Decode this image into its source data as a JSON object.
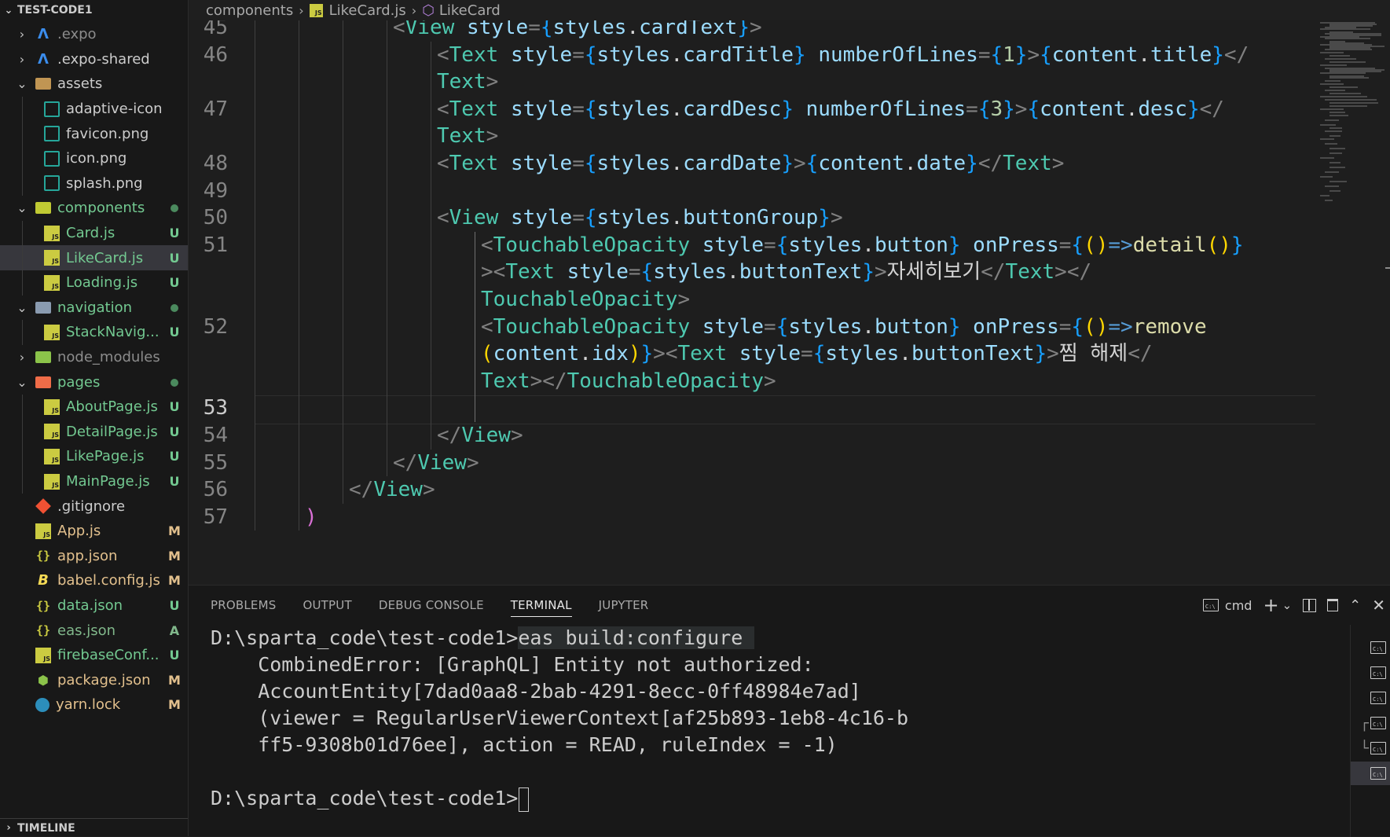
{
  "explorer": {
    "root": "TEST-CODE1",
    "items": [
      {
        "type": "folder",
        "name": ".expo",
        "icon": "expo-folder-icon",
        "expanded": false,
        "depth": 0,
        "status": ""
      },
      {
        "type": "folder",
        "name": ".expo-shared",
        "icon": "expo-folder-icon",
        "expanded": false,
        "depth": 0,
        "status": ""
      },
      {
        "type": "folder",
        "name": "assets",
        "icon": "assets-folder-icon",
        "expanded": true,
        "depth": 0,
        "status": ""
      },
      {
        "type": "file",
        "name": "adaptive-icon.png",
        "icon": "image-file-icon",
        "depth": 1,
        "status": ""
      },
      {
        "type": "file",
        "name": "favicon.png",
        "icon": "image-file-icon",
        "depth": 1,
        "status": ""
      },
      {
        "type": "file",
        "name": "icon.png",
        "icon": "image-file-icon",
        "depth": 1,
        "status": ""
      },
      {
        "type": "file",
        "name": "splash.png",
        "icon": "image-file-icon",
        "depth": 1,
        "status": ""
      },
      {
        "type": "folder",
        "name": "components",
        "icon": "components-folder-icon",
        "expanded": true,
        "depth": 0,
        "status": "dot"
      },
      {
        "type": "file",
        "name": "Card.js",
        "icon": "js-file-icon",
        "depth": 1,
        "status": "U"
      },
      {
        "type": "file",
        "name": "LikeCard.js",
        "icon": "js-file-icon",
        "depth": 1,
        "status": "U",
        "active": true
      },
      {
        "type": "file",
        "name": "Loading.js",
        "icon": "js-file-icon",
        "depth": 1,
        "status": "U"
      },
      {
        "type": "folder",
        "name": "navigation",
        "icon": "navigation-folder-icon",
        "expanded": true,
        "depth": 0,
        "status": "dot"
      },
      {
        "type": "file",
        "name": "StackNavig...",
        "icon": "js-file-icon",
        "depth": 1,
        "status": "U"
      },
      {
        "type": "folder",
        "name": "node_modules",
        "icon": "node-modules-folder-icon",
        "expanded": false,
        "depth": 0,
        "status": "",
        "dim": true
      },
      {
        "type": "folder",
        "name": "pages",
        "icon": "pages-folder-icon",
        "expanded": true,
        "depth": 0,
        "status": "dot"
      },
      {
        "type": "file",
        "name": "AboutPage.js",
        "icon": "js-file-icon",
        "depth": 1,
        "status": "U"
      },
      {
        "type": "file",
        "name": "DetailPage.js",
        "icon": "js-file-icon",
        "depth": 1,
        "status": "U"
      },
      {
        "type": "file",
        "name": "LikePage.js",
        "icon": "js-file-icon",
        "depth": 1,
        "status": "U"
      },
      {
        "type": "file",
        "name": "MainPage.js",
        "icon": "js-file-icon",
        "depth": 1,
        "status": "U"
      },
      {
        "type": "file",
        "name": ".gitignore",
        "icon": "git-file-icon",
        "depth": 0,
        "status": ""
      },
      {
        "type": "file",
        "name": "App.js",
        "icon": "js-file-icon",
        "depth": 0,
        "status": "M"
      },
      {
        "type": "file",
        "name": "app.json",
        "icon": "json-file-icon",
        "depth": 0,
        "status": "M"
      },
      {
        "type": "file",
        "name": "babel.config.js",
        "icon": "babel-file-icon",
        "depth": 0,
        "status": "M"
      },
      {
        "type": "file",
        "name": "data.json",
        "icon": "json-file-icon",
        "depth": 0,
        "status": "U"
      },
      {
        "type": "file",
        "name": "eas.json",
        "icon": "json-file-icon",
        "depth": 0,
        "status": "A"
      },
      {
        "type": "file",
        "name": "firebaseConf...",
        "icon": "js-file-icon",
        "depth": 0,
        "status": "U"
      },
      {
        "type": "file",
        "name": "package.json",
        "icon": "package-json-icon",
        "depth": 0,
        "status": "M"
      },
      {
        "type": "file",
        "name": "yarn.lock",
        "icon": "yarn-file-icon",
        "depth": 0,
        "status": "M"
      }
    ],
    "timeline": "TIMELINE"
  },
  "colors": {
    "untracked": "#73c991",
    "modified": "#e2c08d",
    "added": "#81b88b",
    "dot": "#4b8a5e"
  },
  "breadcrumb": {
    "folder": "components",
    "file": "LikeCard.js",
    "symbol": "LikeCard"
  },
  "editor": {
    "current_line": "53",
    "lines": [
      {
        "num": "45",
        "indent": 4,
        "tokens": [
          [
            "p",
            "<"
          ],
          [
            "g",
            "View"
          ],
          [
            "s",
            " "
          ],
          [
            "a",
            "style"
          ],
          [
            "p",
            "="
          ],
          [
            "b3",
            "{"
          ],
          [
            "a",
            "styles"
          ],
          [
            "t",
            "."
          ],
          [
            "a",
            "cardText"
          ],
          [
            "b3",
            "}"
          ],
          [
            "p",
            ">"
          ]
        ]
      },
      {
        "num": "46",
        "indent": 5,
        "tokens": [
          [
            "p",
            "<"
          ],
          [
            "g",
            "Text"
          ],
          [
            "s",
            " "
          ],
          [
            "a",
            "style"
          ],
          [
            "p",
            "="
          ],
          [
            "b3",
            "{"
          ],
          [
            "a",
            "styles"
          ],
          [
            "t",
            "."
          ],
          [
            "a",
            "cardTitle"
          ],
          [
            "b3",
            "}"
          ],
          [
            "s",
            " "
          ],
          [
            "a",
            "numberOfLines"
          ],
          [
            "p",
            "="
          ],
          [
            "b3",
            "{"
          ],
          [
            "n",
            "1"
          ],
          [
            "b3",
            "}"
          ],
          [
            "p",
            ">"
          ],
          [
            "b3",
            "{"
          ],
          [
            "a",
            "content"
          ],
          [
            "t",
            "."
          ],
          [
            "a",
            "title"
          ],
          [
            "b3",
            "}"
          ],
          [
            "p",
            "</"
          ]
        ]
      },
      {
        "num": "",
        "indent": 5,
        "tokens": [
          [
            "g",
            "Text"
          ],
          [
            "p",
            ">"
          ]
        ]
      },
      {
        "num": "47",
        "indent": 5,
        "tokens": [
          [
            "p",
            "<"
          ],
          [
            "g",
            "Text"
          ],
          [
            "s",
            " "
          ],
          [
            "a",
            "style"
          ],
          [
            "p",
            "="
          ],
          [
            "b3",
            "{"
          ],
          [
            "a",
            "styles"
          ],
          [
            "t",
            "."
          ],
          [
            "a",
            "cardDesc"
          ],
          [
            "b3",
            "}"
          ],
          [
            "s",
            " "
          ],
          [
            "a",
            "numberOfLines"
          ],
          [
            "p",
            "="
          ],
          [
            "b3",
            "{"
          ],
          [
            "n",
            "3"
          ],
          [
            "b3",
            "}"
          ],
          [
            "p",
            ">"
          ],
          [
            "b3",
            "{"
          ],
          [
            "a",
            "content"
          ],
          [
            "t",
            "."
          ],
          [
            "a",
            "desc"
          ],
          [
            "b3",
            "}"
          ],
          [
            "p",
            "</"
          ]
        ]
      },
      {
        "num": "",
        "indent": 5,
        "tokens": [
          [
            "g",
            "Text"
          ],
          [
            "p",
            ">"
          ]
        ]
      },
      {
        "num": "48",
        "indent": 5,
        "tokens": [
          [
            "p",
            "<"
          ],
          [
            "g",
            "Text"
          ],
          [
            "s",
            " "
          ],
          [
            "a",
            "style"
          ],
          [
            "p",
            "="
          ],
          [
            "b3",
            "{"
          ],
          [
            "a",
            "styles"
          ],
          [
            "t",
            "."
          ],
          [
            "a",
            "cardDate"
          ],
          [
            "b3",
            "}"
          ],
          [
            "p",
            ">"
          ],
          [
            "b3",
            "{"
          ],
          [
            "a",
            "content"
          ],
          [
            "t",
            "."
          ],
          [
            "a",
            "date"
          ],
          [
            "b3",
            "}"
          ],
          [
            "p",
            "</"
          ],
          [
            "g",
            "Text"
          ],
          [
            "p",
            ">"
          ]
        ]
      },
      {
        "num": "49",
        "indent": 5,
        "tokens": []
      },
      {
        "num": "50",
        "indent": 5,
        "tokens": [
          [
            "p",
            "<"
          ],
          [
            "g",
            "View"
          ],
          [
            "s",
            " "
          ],
          [
            "a",
            "style"
          ],
          [
            "p",
            "="
          ],
          [
            "b3",
            "{"
          ],
          [
            "a",
            "styles"
          ],
          [
            "t",
            "."
          ],
          [
            "a",
            "buttonGroup"
          ],
          [
            "b3",
            "}"
          ],
          [
            "p",
            ">"
          ]
        ]
      },
      {
        "num": "51",
        "indent": 6,
        "tokens": [
          [
            "p",
            "<"
          ],
          [
            "g",
            "TouchableOpacity"
          ],
          [
            "s",
            " "
          ],
          [
            "a",
            "style"
          ],
          [
            "p",
            "="
          ],
          [
            "b3",
            "{"
          ],
          [
            "a",
            "styles"
          ],
          [
            "t",
            "."
          ],
          [
            "a",
            "button"
          ],
          [
            "b3",
            "}"
          ],
          [
            "s",
            " "
          ],
          [
            "a",
            "onPress"
          ],
          [
            "p",
            "="
          ],
          [
            "b3",
            "{"
          ],
          [
            "b1",
            "()"
          ],
          [
            "k",
            "=>"
          ],
          [
            "f",
            "detail"
          ],
          [
            "b1",
            "()"
          ],
          [
            "b3",
            "}"
          ]
        ]
      },
      {
        "num": "",
        "indent": 6,
        "tokens": [
          [
            "p",
            ">"
          ],
          [
            "p",
            "<"
          ],
          [
            "g",
            "Text"
          ],
          [
            "s",
            " "
          ],
          [
            "a",
            "style"
          ],
          [
            "p",
            "="
          ],
          [
            "b3",
            "{"
          ],
          [
            "a",
            "styles"
          ],
          [
            "t",
            "."
          ],
          [
            "a",
            "buttonText"
          ],
          [
            "b3",
            "}"
          ],
          [
            "p",
            ">"
          ],
          [
            "t",
            "자세히보기"
          ],
          [
            "p",
            "</"
          ],
          [
            "g",
            "Text"
          ],
          [
            "p",
            "></"
          ]
        ]
      },
      {
        "num": "",
        "indent": 6,
        "tokens": [
          [
            "g",
            "TouchableOpacity"
          ],
          [
            "p",
            ">"
          ]
        ]
      },
      {
        "num": "52",
        "indent": 6,
        "tokens": [
          [
            "p",
            "<"
          ],
          [
            "g",
            "TouchableOpacity"
          ],
          [
            "s",
            " "
          ],
          [
            "a",
            "style"
          ],
          [
            "p",
            "="
          ],
          [
            "b3",
            "{"
          ],
          [
            "a",
            "styles"
          ],
          [
            "t",
            "."
          ],
          [
            "a",
            "button"
          ],
          [
            "b3",
            "}"
          ],
          [
            "s",
            " "
          ],
          [
            "a",
            "onPress"
          ],
          [
            "p",
            "="
          ],
          [
            "b3",
            "{"
          ],
          [
            "b1",
            "()"
          ],
          [
            "k",
            "=>"
          ],
          [
            "f",
            "remove"
          ]
        ]
      },
      {
        "num": "",
        "indent": 6,
        "tokens": [
          [
            "b1",
            "("
          ],
          [
            "a",
            "content"
          ],
          [
            "t",
            "."
          ],
          [
            "a",
            "idx"
          ],
          [
            "b1",
            ")"
          ],
          [
            "b3",
            "}"
          ],
          [
            "p",
            ">"
          ],
          [
            "p",
            "<"
          ],
          [
            "g",
            "Text"
          ],
          [
            "s",
            " "
          ],
          [
            "a",
            "style"
          ],
          [
            "p",
            "="
          ],
          [
            "b3",
            "{"
          ],
          [
            "a",
            "styles"
          ],
          [
            "t",
            "."
          ],
          [
            "a",
            "buttonText"
          ],
          [
            "b3",
            "}"
          ],
          [
            "p",
            ">"
          ],
          [
            "t",
            "찜 해제"
          ],
          [
            "p",
            "</"
          ]
        ]
      },
      {
        "num": "",
        "indent": 6,
        "tokens": [
          [
            "g",
            "Text"
          ],
          [
            "p",
            "></"
          ],
          [
            "g",
            "TouchableOpacity"
          ],
          [
            "p",
            ">"
          ]
        ]
      },
      {
        "num": "53",
        "indent": 6,
        "tokens": []
      },
      {
        "num": "54",
        "indent": 5,
        "tokens": [
          [
            "p",
            "</"
          ],
          [
            "g",
            "View"
          ],
          [
            "p",
            ">"
          ]
        ]
      },
      {
        "num": "55",
        "indent": 4,
        "tokens": [
          [
            "p",
            "</"
          ],
          [
            "g",
            "View"
          ],
          [
            "p",
            ">"
          ]
        ]
      },
      {
        "num": "56",
        "indent": 3,
        "tokens": [
          [
            "p",
            "</"
          ],
          [
            "g",
            "View"
          ],
          [
            "p",
            ">"
          ]
        ]
      },
      {
        "num": "57",
        "indent": 2,
        "tokens": [
          [
            "b2",
            ")"
          ]
        ]
      }
    ]
  },
  "panel": {
    "tabs": [
      {
        "label": "PROBLEMS",
        "active": false
      },
      {
        "label": "OUTPUT",
        "active": false
      },
      {
        "label": "DEBUG CONSOLE",
        "active": false
      },
      {
        "label": "TERMINAL",
        "active": true
      },
      {
        "label": "JUPYTER",
        "active": false
      }
    ],
    "terminal_name": "cmd",
    "terminal_list_count": 6,
    "terminal": {
      "prompt1": "D:\\sparta_code\\test-code1>",
      "command": "eas build:configure ",
      "error_lines": [
        "    CombinedError: [GraphQL] Entity not authorized:",
        "    AccountEntity[7dad0aa8-2bab-4291-8ecc-0ff48984e7ad]",
        "    (viewer = RegularUserViewerContext[af25b893-1eb8-4c16-b",
        "    ff5-9308b01d76ee], action = READ, ruleIndex = -1)"
      ],
      "prompt2": "D:\\sparta_code\\test-code1>"
    }
  }
}
